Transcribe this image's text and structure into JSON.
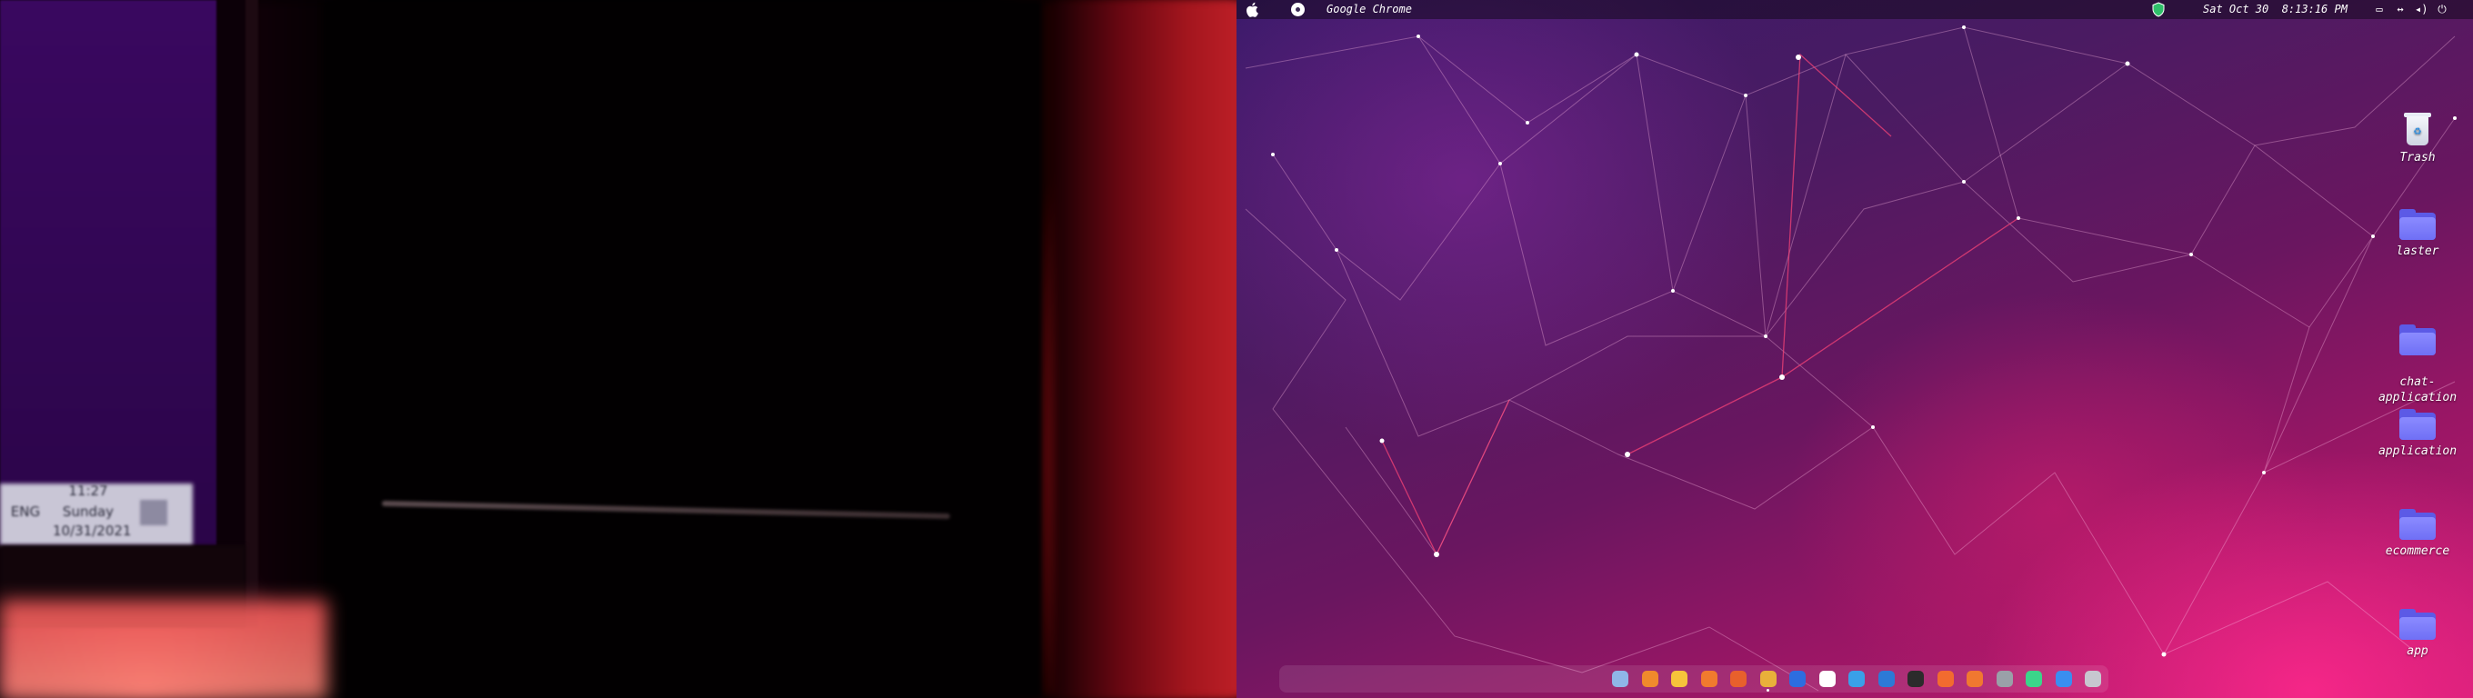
{
  "menubar": {
    "app_name": "Google Chrome",
    "clock": "Sat Oct 30  8:13:16 PM"
  },
  "photo_screen": {
    "left_text": "ENG",
    "time": "11:27",
    "day": "Sunday",
    "date": "10/31/2021"
  },
  "desktop_icons": [
    {
      "label": "Trash",
      "icon": "trash-icon"
    },
    {
      "label": "laster",
      "icon": "home-folder-icon"
    },
    {
      "label": "chat-\napplication",
      "icon": "folder-icon"
    },
    {
      "label": "application",
      "icon": "folder-icon"
    },
    {
      "label": "ecommerce",
      "icon": "folder-icon"
    },
    {
      "label": "app",
      "icon": "folder-icon"
    }
  ],
  "dock": [
    {
      "name": "finder-icon",
      "color": "#8fb6e8"
    },
    {
      "name": "launcher-icon",
      "color": "#f08a2c"
    },
    {
      "name": "files-icon",
      "color": "#f6c33b"
    },
    {
      "name": "app-store-icon",
      "color": "#f07a2e"
    },
    {
      "name": "firefox-icon",
      "color": "#e8602c"
    },
    {
      "name": "chrome-icon",
      "color": "#e9b03a"
    },
    {
      "name": "zoom-icon",
      "color": "#2d6de0"
    },
    {
      "name": "password-manager-icon",
      "color": "#ffffff"
    },
    {
      "name": "notes-icon",
      "color": "#3aa0e8"
    },
    {
      "name": "vscode-icon",
      "color": "#2c7ad6"
    },
    {
      "name": "terminal-icon",
      "color": "#2b2b2b"
    },
    {
      "name": "postman-icon",
      "color": "#f26b2f"
    },
    {
      "name": "brush-icon",
      "color": "#f07830"
    },
    {
      "name": "settings-icon",
      "color": "#9aa0a8"
    },
    {
      "name": "app-icon",
      "color": "#3bd58a"
    },
    {
      "name": "browser-icon",
      "color": "#3a8ef0"
    },
    {
      "name": "trash-dock-icon",
      "color": "#c7c7cf"
    }
  ]
}
